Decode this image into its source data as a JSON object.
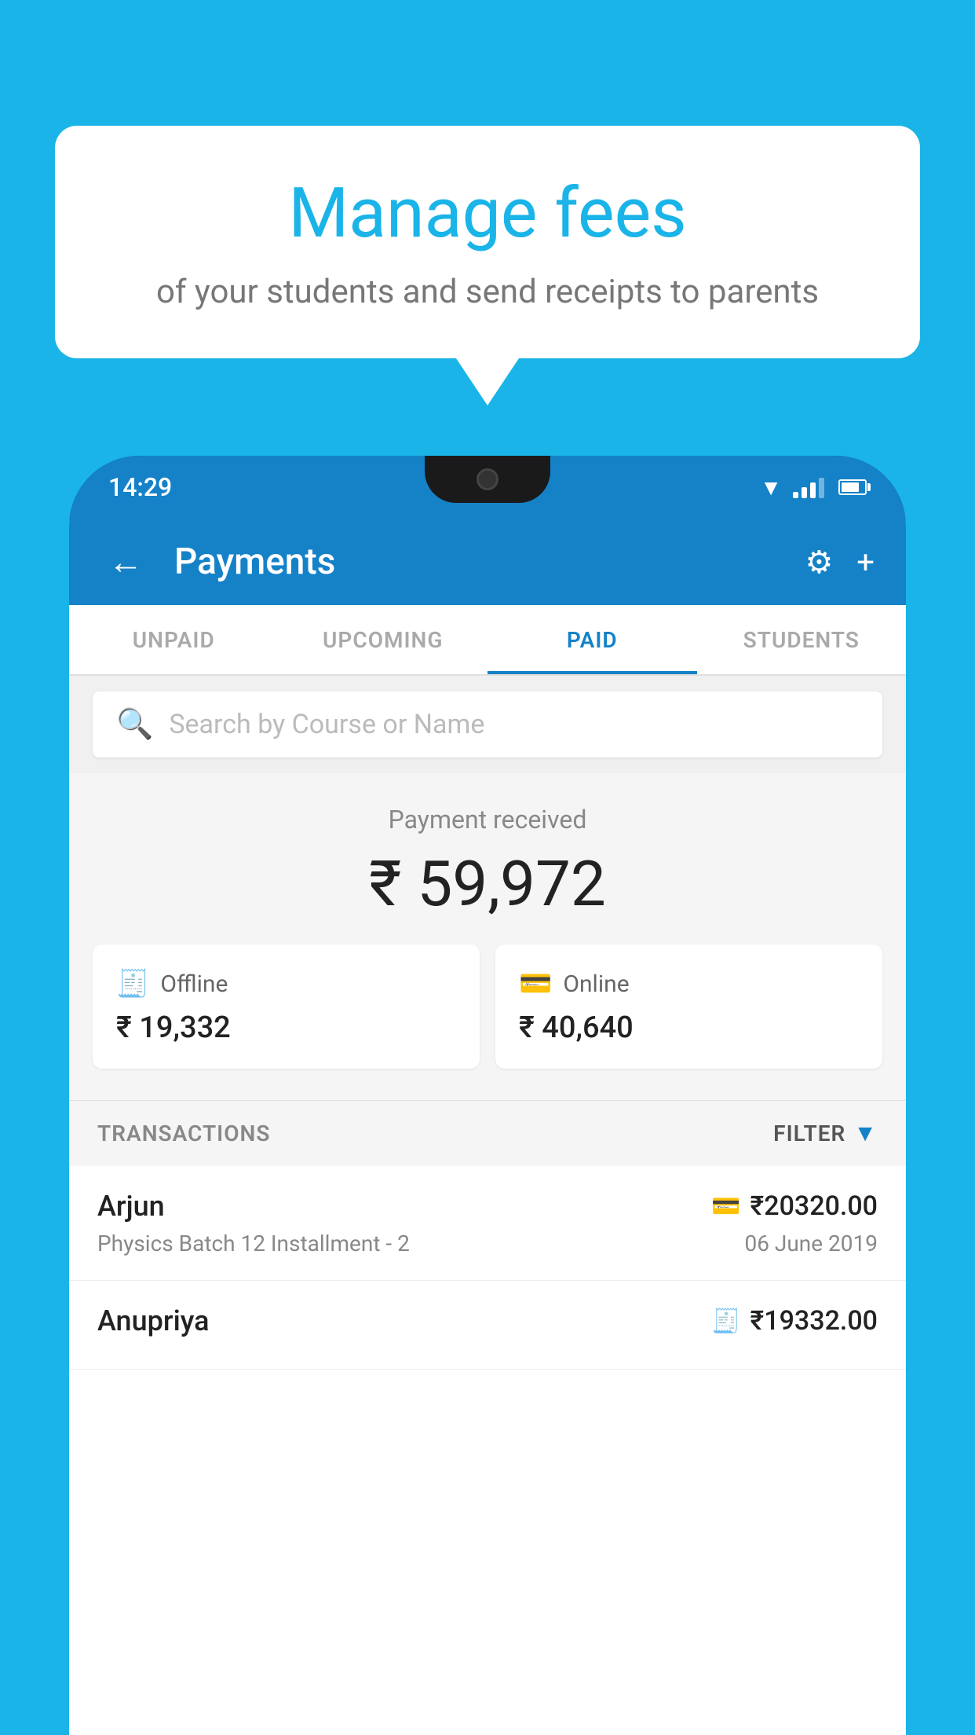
{
  "background_color": "#1ab4e8",
  "speech_bubble": {
    "title": "Manage fees",
    "subtitle": "of your students and send receipts to parents"
  },
  "status_bar": {
    "time": "14:29"
  },
  "toolbar": {
    "title": "Payments",
    "back_label": "←",
    "settings_label": "⚙",
    "add_label": "+"
  },
  "tabs": [
    {
      "id": "unpaid",
      "label": "UNPAID",
      "active": false
    },
    {
      "id": "upcoming",
      "label": "UPCOMING",
      "active": false
    },
    {
      "id": "paid",
      "label": "PAID",
      "active": true
    },
    {
      "id": "students",
      "label": "STUDENTS",
      "active": false
    }
  ],
  "search": {
    "placeholder": "Search by Course or Name"
  },
  "payment_summary": {
    "received_label": "Payment received",
    "total_amount": "₹ 59,972",
    "offline": {
      "label": "Offline",
      "amount": "₹ 19,332"
    },
    "online": {
      "label": "Online",
      "amount": "₹ 40,640"
    }
  },
  "transactions": {
    "header_label": "TRANSACTIONS",
    "filter_label": "FILTER",
    "rows": [
      {
        "name": "Arjun",
        "course": "Physics Batch 12 Installment - 2",
        "amount": "₹20320.00",
        "date": "06 June 2019",
        "type": "online"
      },
      {
        "name": "Anupriya",
        "course": "",
        "amount": "₹19332.00",
        "date": "",
        "type": "offline"
      }
    ]
  }
}
